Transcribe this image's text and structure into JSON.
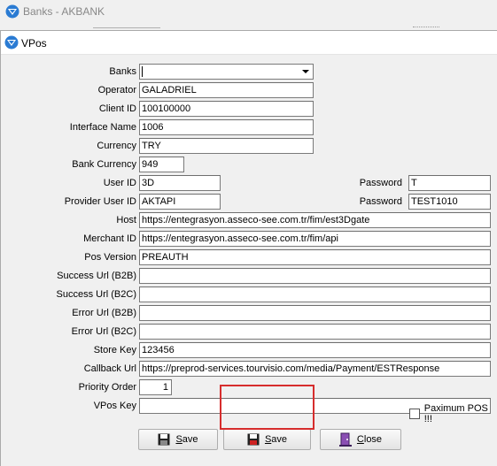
{
  "outer_window": {
    "title": "Banks - AKBANK"
  },
  "dialog": {
    "title": "VPos"
  },
  "form": {
    "banks": {
      "label": "Banks",
      "value": ""
    },
    "operator": {
      "label": "Operator",
      "value": "GALADRIEL"
    },
    "client_id": {
      "label": "Client ID",
      "value": "100100000"
    },
    "interface_name": {
      "label": "Interface Name",
      "value": "1006"
    },
    "currency": {
      "label": "Currency",
      "value": "TRY"
    },
    "bank_currency": {
      "label": "Bank Currency",
      "value": "949"
    },
    "user_id": {
      "label": "User ID",
      "value": "3D"
    },
    "password": {
      "label": "Password",
      "value": "T"
    },
    "provider_user_id": {
      "label": "Provider User ID",
      "value": "AKTAPI"
    },
    "provider_password": {
      "label": "Password",
      "value": "TEST1010"
    },
    "host": {
      "label": "Host",
      "value": "https://entegrasyon.asseco-see.com.tr/fim/est3Dgate"
    },
    "merchant_id": {
      "label": "Merchant ID",
      "value": "https://entegrasyon.asseco-see.com.tr/fim/api"
    },
    "pos_version": {
      "label": "Pos Version",
      "value": "PREAUTH"
    },
    "success_url_b2b": {
      "label": "Success Url (B2B)",
      "value": ""
    },
    "success_url_b2c": {
      "label": "Success Url (B2C)",
      "value": ""
    },
    "error_url_b2b": {
      "label": "Error Url (B2B)",
      "value": ""
    },
    "error_url_b2c": {
      "label": "Error Url (B2C)",
      "value": ""
    },
    "store_key": {
      "label": "Store Key",
      "value": "123456"
    },
    "callback_url": {
      "label": "Callback Url",
      "value": "https://preprod-services.tourvisio.com/media/Payment/ESTResponse"
    },
    "priority_order": {
      "label": "Priority Order",
      "value": "1"
    },
    "vpos_key": {
      "label": "VPos Key",
      "value": ""
    }
  },
  "buttons": {
    "save1": "Save",
    "save2": "Save",
    "close": "Close"
  },
  "checkbox": {
    "label": "Paximum POS !!!",
    "checked": false
  },
  "colors": {
    "highlight": "#d62d2d",
    "icon_blue": "#1e73be"
  }
}
